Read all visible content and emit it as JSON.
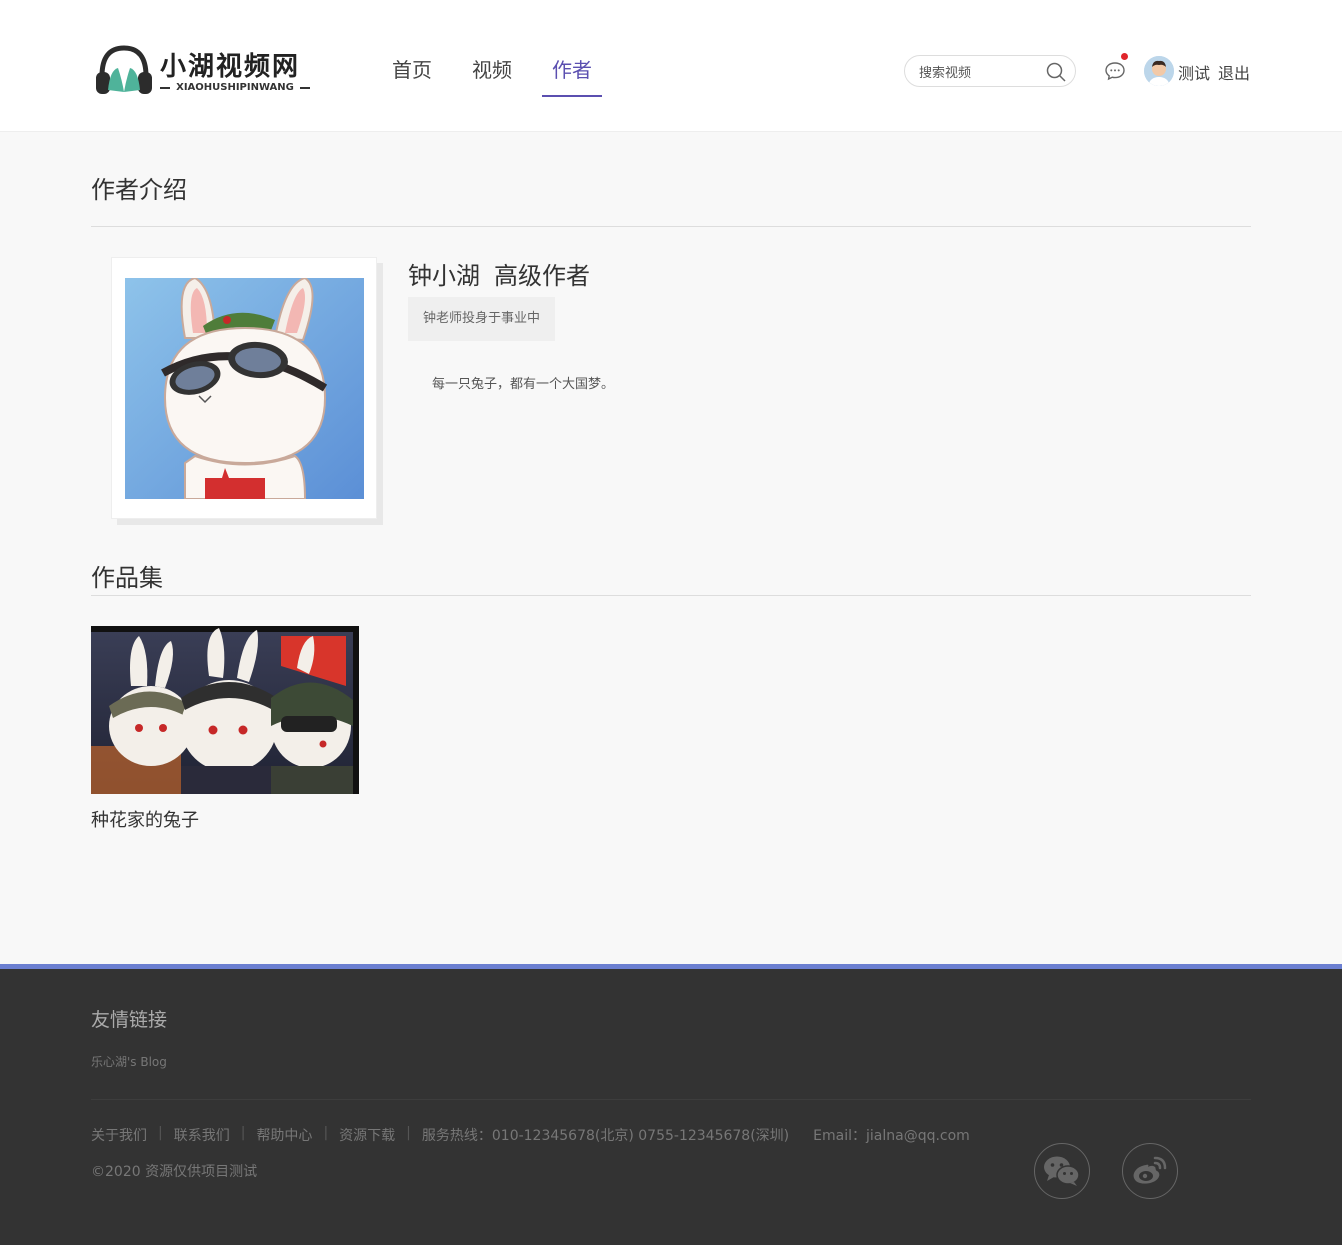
{
  "header": {
    "logo_title": "小湖视频网",
    "logo_subtitle": "XIAOHUSHIPINWANG",
    "nav": [
      {
        "label": "首页",
        "active": false
      },
      {
        "label": "视频",
        "active": false
      },
      {
        "label": "作者",
        "active": true
      }
    ],
    "search_placeholder": "搜索视频",
    "user_name": "测试",
    "logout_label": "退出",
    "accent_color": "#5b4fb0"
  },
  "author_section": {
    "title": "作者介绍",
    "name": "钟小湖",
    "level": "高级作者",
    "tag": "钟老师投身于事业中",
    "description": "每一只兔子，都有一个大国梦。"
  },
  "works_section": {
    "title": "作品集",
    "items": [
      {
        "title": "种花家的兔子"
      }
    ]
  },
  "footer": {
    "links_title": "友情链接",
    "friend_link": "乐心湖's Blog",
    "nav": [
      "关于我们",
      "联系我们",
      "帮助中心",
      "资源下载"
    ],
    "hotline": "服务热线：010-12345678(北京) 0755-12345678(深圳)",
    "email": "Email：jialna@qq.com",
    "copyright": "©2020 资源仅供项目测试",
    "social_icons": [
      "wechat-icon",
      "weibo-icon"
    ],
    "accent_border": "#6b7fd1"
  }
}
